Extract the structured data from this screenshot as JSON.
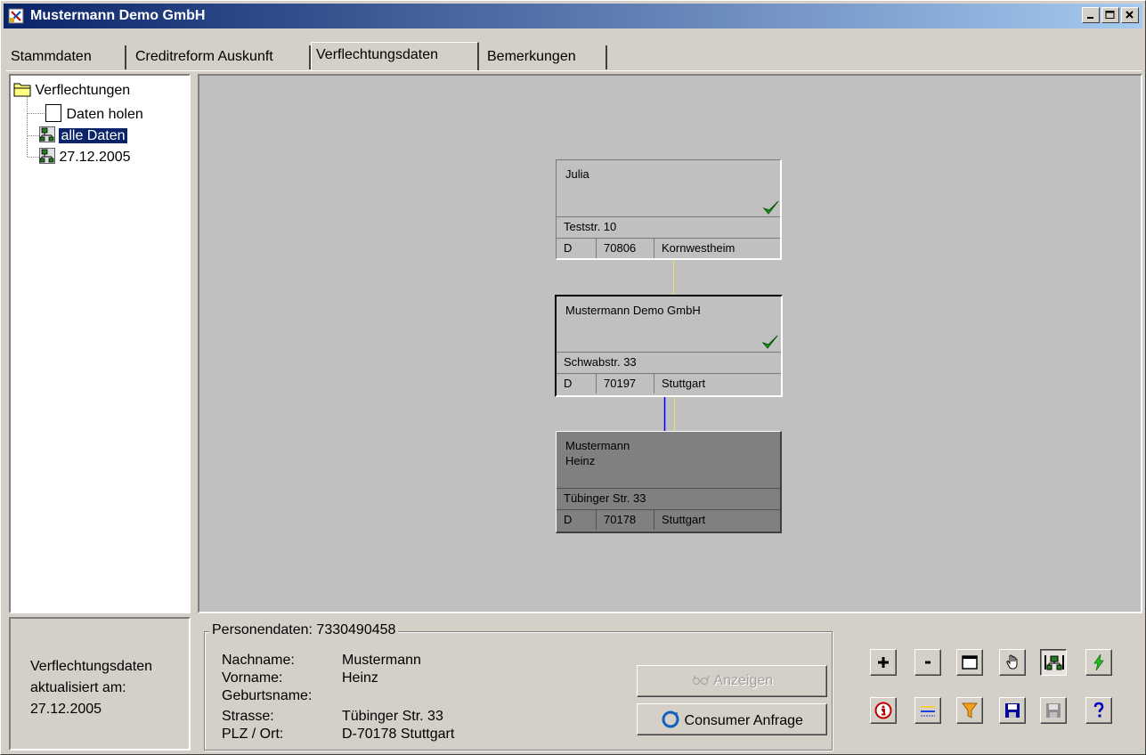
{
  "window": {
    "title": "Mustermann Demo GmbH"
  },
  "tabs": [
    {
      "label": "Stammdaten"
    },
    {
      "label": "Creditreform Auskunft"
    },
    {
      "label": "Verflechtungsdaten"
    },
    {
      "label": "Bemerkungen"
    }
  ],
  "tree": {
    "root": "Verflechtungen",
    "items": [
      {
        "label": "Daten holen"
      },
      {
        "label": "alle Daten"
      },
      {
        "label": "27.12.2005"
      }
    ]
  },
  "nodes": [
    {
      "name": "Julia",
      "name2": "",
      "street": "Teststr. 10",
      "country": "D",
      "zip": "70806",
      "city": "Kornwestheim",
      "verified": true
    },
    {
      "name": "Mustermann Demo GmbH",
      "name2": "",
      "street": "Schwabstr. 33",
      "country": "D",
      "zip": "70197",
      "city": "Stuttgart",
      "verified": true
    },
    {
      "name": "Mustermann",
      "name2": "Heinz",
      "street": "Tübinger Str. 33",
      "country": "D",
      "zip": "70178",
      "city": "Stuttgart",
      "verified": false
    }
  ],
  "status": {
    "line1": "Verflechtungsdaten",
    "line2": "aktualisiert am:",
    "line3": "27.12.2005"
  },
  "person": {
    "title": "Personendaten: 7330490458",
    "fields": [
      {
        "label": "Nachname:",
        "value": "Mustermann"
      },
      {
        "label": "Vorname:",
        "value": "Heinz"
      },
      {
        "label": "Geburtsname:",
        "value": ""
      },
      {
        "label": "Strasse:",
        "value": "Tübinger Str. 33"
      },
      {
        "label": "PLZ / Ort:",
        "value": "D-70178 Stuttgart"
      }
    ]
  },
  "buttons": {
    "show": "Anzeigen",
    "consumer": "Consumer Anfrage"
  },
  "toolbar": [
    {
      "icon": "plus-icon"
    },
    {
      "icon": "minus-icon"
    },
    {
      "icon": "window-icon"
    },
    {
      "icon": "hand-icon"
    },
    {
      "icon": "network-icon",
      "pressed": true
    },
    {
      "icon": "lightning-icon"
    },
    {
      "icon": "info-icon"
    },
    {
      "icon": "lines-icon"
    },
    {
      "icon": "filter-icon"
    },
    {
      "icon": "save-icon"
    },
    {
      "icon": "save-disabled-icon"
    },
    {
      "icon": "help-icon"
    }
  ],
  "colors": {
    "titlebar_start": "#0a246a",
    "link_yellow": "#f0e060",
    "link_blue": "#0000ff",
    "check_green": "#109a10",
    "selected_bg": "#0a246a"
  }
}
